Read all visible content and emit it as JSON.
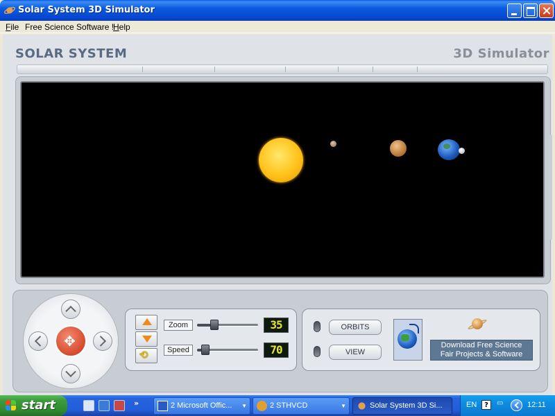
{
  "window": {
    "title": "Solar System 3D Simulator",
    "icon": "saturn-app-icon"
  },
  "menu": [
    {
      "pre": "",
      "ul": "F",
      "post": "ile"
    },
    {
      "pre": "Free Science Software !",
      "ul": "",
      "post": ""
    },
    {
      "pre": "",
      "ul": "H",
      "post": "elp"
    }
  ],
  "header": {
    "left": "SOLAR SYSTEM",
    "right": "3D Simulator"
  },
  "viewport": {
    "background": "#000000",
    "bodies": [
      "sun",
      "mercury",
      "venus",
      "earth",
      "moon"
    ]
  },
  "navigation": {
    "center_icon": "✥"
  },
  "zoom_panel": {
    "zoom_label": "Zoom",
    "zoom_value": "35",
    "zoom_level": 0.25,
    "speed_label": "Speed",
    "speed_value": "70",
    "speed_level": 0.08,
    "reset_icon": "⟲"
  },
  "mode_panel": {
    "orbits_label": "ORBITS",
    "view_label": "VIEW",
    "download_line1": "Download Free Science",
    "download_line2": "Fair Projects & Software"
  },
  "taskbar": {
    "start_label": "start",
    "quicklaunch_more": "»",
    "tasks": [
      {
        "label": "2 Microsoft Offic...",
        "caret": "▼"
      },
      {
        "label": "2 STHVCD",
        "caret": "▼"
      },
      {
        "label": "Solar System 3D Si...",
        "caret": ""
      }
    ],
    "tray": {
      "language": "EN",
      "help": "?",
      "clock": "12:11"
    }
  },
  "colors": {
    "titlebar": "#0a5be0",
    "panel": "#c8cdd3",
    "header_text": "#5a6a82",
    "lcd_text": "#e8e23a",
    "dpad_center": "#d64a2c",
    "download_box": "#5e7894"
  }
}
